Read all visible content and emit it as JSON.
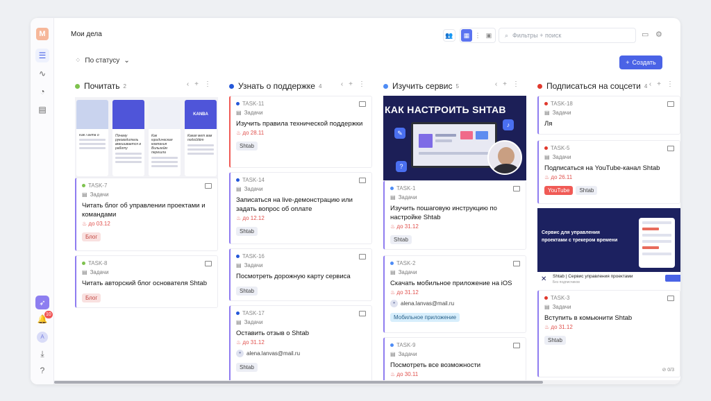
{
  "app": {
    "logo_letter": "M",
    "page_title": "Мои дела",
    "notifications_count": "10",
    "user_initial": "A"
  },
  "toolbar": {
    "filter_placeholder": "Фильтры + поиск",
    "group_by": "По статусу",
    "create_label": "Создать"
  },
  "colors": {
    "accent": "#4a63e6",
    "green": "#7ec24e",
    "blue": "#2457d8",
    "lightblue": "#4e8cf5",
    "red": "#e0392d"
  },
  "columns": [
    {
      "title": "Почитать",
      "count": "2",
      "dot": "#7ec24e",
      "cover_blog": {
        "items": [
          {
            "top": "",
            "h": "Как Ганта о"
          },
          {
            "top": "",
            "h": "Почему руководитель вмешивается в работу"
          },
          {
            "top": "",
            "h": "Как юридическая компания Вильгейм перешла"
          },
          {
            "top": "KANBA",
            "h": "Какая мет вам подойдёт"
          }
        ]
      },
      "cards": [
        {
          "id": "TASK-7",
          "project": "Задачи",
          "title": "Читать блог об управлении проектами и командами",
          "due": "до 03.12",
          "tags": [
            "Блог"
          ]
        },
        {
          "id": "TASK-8",
          "project": "Задачи",
          "title": "Читать авторский блог основателя Shtab",
          "tags": [
            "Блог"
          ]
        }
      ]
    },
    {
      "title": "Узнать о поддержке",
      "count": "4",
      "dot": "#2457d8",
      "cards": [
        {
          "id": "TASK-11",
          "project": "Задачи",
          "title": "Изучить правила технической поддержки",
          "due": "до 28.11",
          "tags": [
            "Shtab"
          ]
        },
        {
          "id": "TASK-14",
          "project": "Задачи",
          "title": "Записаться на live-демонстрацию или задать вопрос об оплате",
          "due": "до 12.12",
          "tags": [
            "Shtab"
          ]
        },
        {
          "id": "TASK-16",
          "project": "Задачи",
          "title": "Посмотреть дорожную карту сервиса",
          "tags": [
            "Shtab"
          ]
        },
        {
          "id": "TASK-17",
          "project": "Задачи",
          "title": "Оставить отзыв о Shtab",
          "due": "до 31.12",
          "assignee": "alena.lanvas@mail.ru",
          "tags": [
            "Shtab"
          ]
        }
      ]
    },
    {
      "title": "Изучить сервис",
      "count": "5",
      "dot": "#4e8cf5",
      "cover_heading": "КАК НАСТРОИТЬ SHTAB",
      "cards": [
        {
          "id": "TASK-1",
          "project": "Задачи",
          "title": "Изучить пошаговую инструкцию по настройке Shtab",
          "due": "до 31.12",
          "tags": [
            "Shtab"
          ]
        },
        {
          "id": "TASK-2",
          "project": "Задачи",
          "title": "Скачать мобильное приложение на iOS",
          "due": "до 31.12",
          "assignee": "alena.lanvas@mail.ru",
          "tags": [
            "Мобильное приложение"
          ]
        },
        {
          "id": "TASK-9",
          "project": "Задачи",
          "title": "Посмотреть все возможности",
          "due": "до 30.11"
        }
      ]
    },
    {
      "title": "Подписаться на соцсети",
      "count": "4",
      "dot": "#e0392d",
      "cover_web": {
        "headline": "Сервис для управления проектами с трекером времени",
        "footer_title": "Shtab | Сервис управления проектами",
        "footer_sub": "Без подписчиков"
      },
      "cards": [
        {
          "id": "TASK-18",
          "project": "Задачи",
          "title": "Ля"
        },
        {
          "id": "TASK-5",
          "project": "Задачи",
          "title": "Подписаться на YouTube-канал Shtab",
          "due": "до 26.11",
          "tags": [
            "YouTube",
            "Shtab"
          ]
        },
        {
          "id": "TASK-3",
          "project": "Задачи",
          "title": "Вступить в комьюнити Shtab",
          "due": "до 31.12",
          "tags": [
            "Shtab"
          ],
          "subtasks": "0/3"
        }
      ]
    }
  ]
}
